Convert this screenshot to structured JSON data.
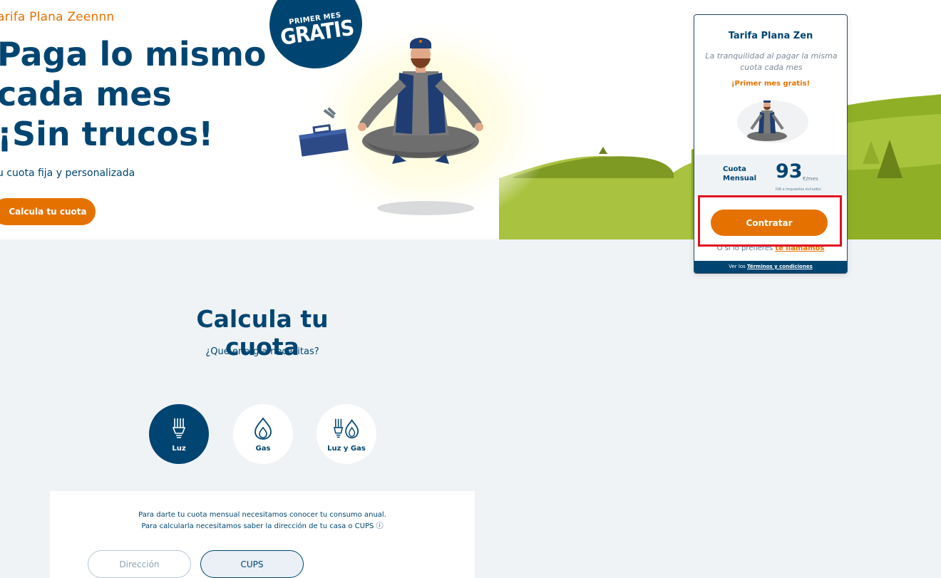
{
  "hero": {
    "eyebrow": "arifa Plana Zeennn",
    "title_line1": "Paga lo mismo",
    "title_line2": "cada mes",
    "title_line3": "¡Sin trucos!",
    "subtitle": "u cuota fija y personalizada",
    "cta_label": "Calcula tu cuota",
    "badge_top": "PRIMER MES",
    "badge_main": "GRATIS"
  },
  "card": {
    "title": "Tarifa Plana Zen",
    "description": "La tranquilidad al pagar la misma cuota cada mes",
    "promo": "¡Primer mes gratis!",
    "price_label": "Cuota Mensual",
    "price_value": "93",
    "price_unit": "€/mes",
    "price_note": "IVA e impuestos incluidos",
    "contract_label": "Contratar",
    "call_prefix": "O si lo prefieres",
    "call_link": "te llamamos",
    "footer_prefix": "Ver los",
    "footer_link": "Términos y condiciones"
  },
  "calculator": {
    "title": "Calcula tu cuota",
    "subtitle": "¿Qué energía necesitas?",
    "options": [
      {
        "label": "Luz",
        "icon": "bulb-icon",
        "selected": true
      },
      {
        "label": "Gas",
        "icon": "flame-icon",
        "selected": false
      },
      {
        "label": "Luz y Gas",
        "icon": "bulb-flame-icon",
        "selected": false
      }
    ],
    "info_line1": "Para darte tu cuota mensual necesitamos conocer tu consumo anual.",
    "info_line2": "Para calcularla necesitamos saber la dirección de tu casa o CUPS",
    "info_icon": "ⓘ",
    "tabs": [
      {
        "label": "Dirección",
        "selected": false
      },
      {
        "label": "CUPS",
        "selected": true
      }
    ]
  },
  "colors": {
    "brand_navy": "#004571",
    "brand_orange": "#e57200",
    "highlight_red": "#e01020"
  }
}
